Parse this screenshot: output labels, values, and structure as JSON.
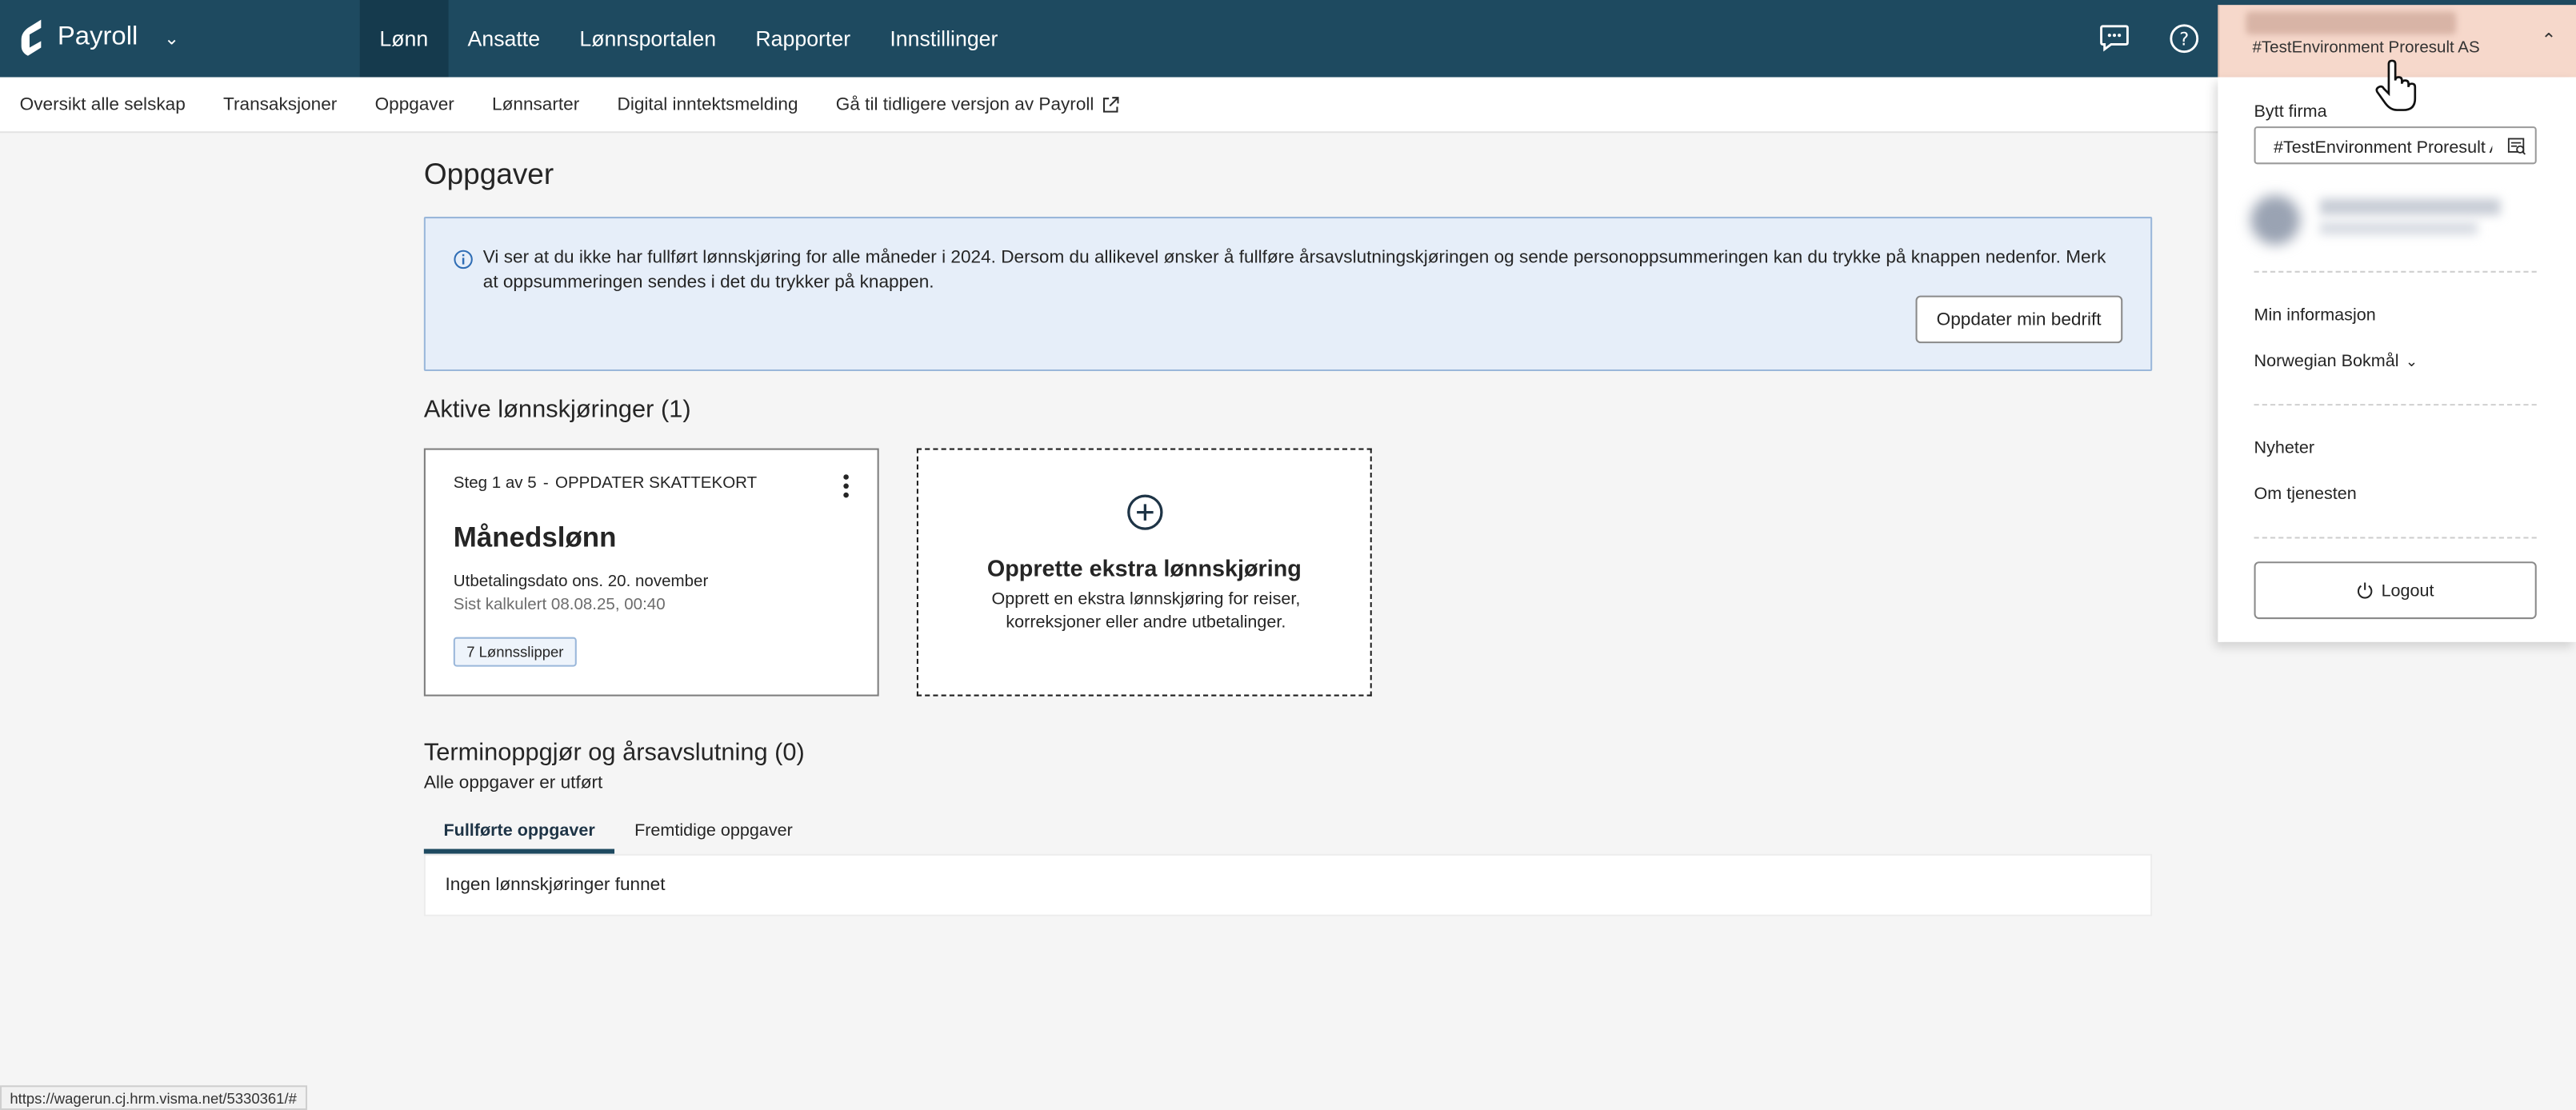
{
  "app": {
    "name": "Payroll"
  },
  "nav": {
    "items": [
      {
        "label": "Lønn",
        "active": true
      },
      {
        "label": "Ansatte",
        "active": false
      },
      {
        "label": "Lønnsportalen",
        "active": false
      },
      {
        "label": "Rapporter",
        "active": false
      },
      {
        "label": "Innstillinger",
        "active": false
      }
    ]
  },
  "company": {
    "name": "#TestEnvironment Proresult AS"
  },
  "subnav": {
    "items": [
      "Oversikt alle selskap",
      "Transaksjoner",
      "Oppgaver",
      "Lønnsarter",
      "Digital inntektsmelding",
      "Gå til tidligere versjon av Payroll"
    ]
  },
  "main": {
    "title": "Oppgaver",
    "alert": {
      "text": "Vi ser at du ikke har fullført lønnskjøring for alle måneder i 2024. Dersom du allikevel ønsker å fullføre årsavslutningskjøringen og sende personoppsummeringen kan du trykke på knappen nedenfor. Merk at oppsummeringen sendes i det du trykker på knappen.",
      "button": "Oppdater min bedrift"
    },
    "active_runs": {
      "title": "Aktive lønnskjøringer (1)",
      "card": {
        "step": "Steg 1 av 5",
        "step_sep": "-",
        "step_name": "OPPDATER SKATTEKORT",
        "title": "Månedslønn",
        "date": "Utbetalingsdato ons. 20. november",
        "calc": "Sist kalkulert 08.08.25, 00:40",
        "badge": "7 Lønnsslipper"
      },
      "create": {
        "title": "Opprette ekstra lønnskjøring",
        "desc": "Opprett en ekstra lønnskjøring for reiser, korreksjoner eller andre utbetalinger."
      }
    },
    "termin": {
      "title": "Terminoppgjør og årsavslutning (0)",
      "desc": "Alle oppgaver er utført",
      "tabs": [
        "Fullførte oppgaver",
        "Fremtidige oppgaver"
      ],
      "empty": "Ingen lønnskjøringer funnet"
    }
  },
  "dropdown": {
    "switch_label": "Bytt firma",
    "company_value": "#TestEnvironment Proresult AS",
    "items": [
      "Min informasjon",
      "Norwegian Bokmål",
      "Nyheter",
      "Om tjenesten"
    ],
    "logout": "Logout"
  },
  "statusbar": {
    "url": "https://wagerun.cj.hrm.visma.net/5330361/#"
  },
  "colors": {
    "topbar": "#1e4a60",
    "active_nav": "#153a4d",
    "company_bg": "#f6d8cb",
    "alert_bg": "#e6eef9"
  }
}
